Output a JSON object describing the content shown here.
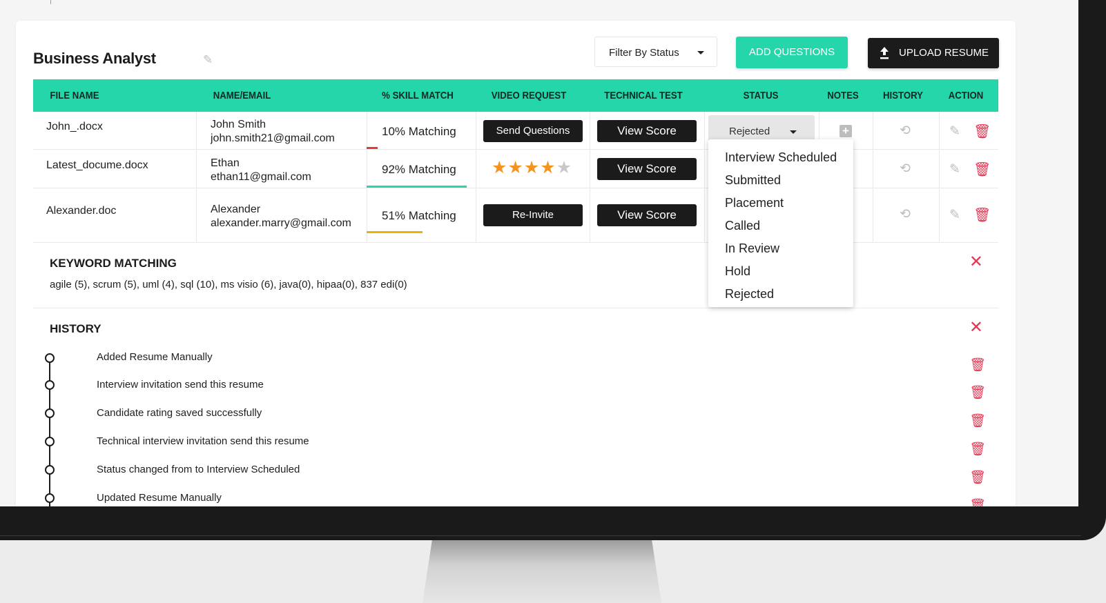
{
  "header": {
    "title": "Business Analyst",
    "filter_label": "Filter By Status",
    "add_questions_label": "ADD QUESTIONS",
    "upload_resume_label": "UPLOAD RESUME"
  },
  "table": {
    "columns": [
      "FILE NAME",
      "NAME/EMAIL",
      "% SKILL MATCH",
      "VIDEO REQUEST",
      "TECHNICAL TEST",
      "STATUS",
      "NOTES",
      "HISTORY",
      "ACTION"
    ],
    "rows": [
      {
        "file": "John_.docx",
        "name": "John Smith",
        "email": "john.smith21@gmail.com",
        "match": "10% Matching",
        "match_value": 0.1,
        "match_color": "#e53935",
        "video_request": "Send Questions",
        "technical_test": "View Score",
        "status": "Rejected"
      },
      {
        "file": "Latest_docume.docx",
        "name": "Ethan",
        "email": "ethan11@gmail.com",
        "match": "92% Matching",
        "match_value": 0.92,
        "match_color": "#24d6a9",
        "rating": 4,
        "rating_max": 5,
        "technical_test": "View Score"
      },
      {
        "file": "Alexander.doc",
        "name": "Alexander",
        "email": "alexander.marry@gmail.com",
        "match": "51% Matching",
        "match_value": 0.51,
        "match_color": "#e8b400",
        "video_request": "Re-Invite",
        "technical_test": "View Score"
      }
    ]
  },
  "status_dropdown": {
    "options": [
      "Interview Scheduled",
      "Submitted",
      "Placement",
      "Called",
      "In Review",
      "Hold",
      "Rejected"
    ]
  },
  "keyword_matching": {
    "title": "KEYWORD MATCHING",
    "text": "agile (5), scrum (5), uml (4), sql (10), ms visio (6), java(0), hipaa(0), 837 edi(0)"
  },
  "history": {
    "title": "HISTORY",
    "items": [
      "Added Resume Manually",
      "Interview invitation send this resume",
      "Candidate rating saved successfully",
      "Technical interview invitation send this resume",
      "Status changed from to Interview Scheduled",
      "Updated Resume Manually"
    ]
  },
  "colors": {
    "accent": "#24d6a9",
    "danger": "#e63552",
    "dark_button": "#1b1b1b",
    "star": "#f5931f"
  },
  "icons": {
    "edit": "pencil-icon",
    "delete": "trash-icon",
    "history": "history-icon",
    "notes": "plus-square-icon",
    "close": "close-icon",
    "upload": "upload-icon"
  }
}
